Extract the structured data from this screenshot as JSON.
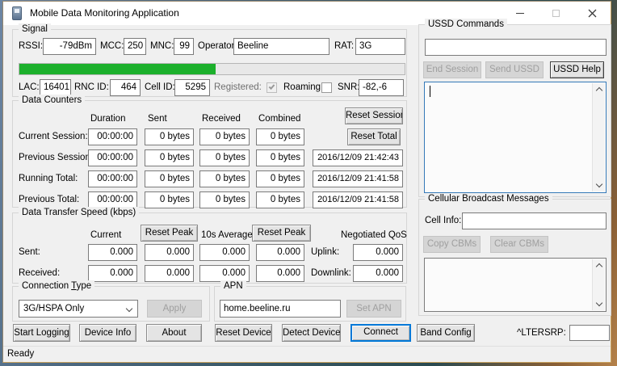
{
  "window": {
    "title": "Mobile Data Monitoring Application"
  },
  "signal": {
    "label": "Signal",
    "rssi_label": "RSSI:",
    "rssi_value": "-79dBm",
    "mcc_label": "MCC:",
    "mcc_value": "250",
    "mnc_label": "MNC:",
    "mnc_value": "99",
    "operator_label": "Operator:",
    "operator_value": "Beeline",
    "rat_label": "RAT:",
    "rat_value": "3G",
    "strength_percent": 51,
    "lac_label": "LAC:",
    "lac_value": "16401",
    "rnc_label": "RNC ID:",
    "rnc_value": "464",
    "cell_label": "Cell ID:",
    "cell_value": "5295",
    "registered_label": "Registered:",
    "registered_checked": true,
    "roaming_label": "Roaming:",
    "roaming_checked": false,
    "snr_label": "SNR:",
    "snr_value": "-82,-6"
  },
  "counters": {
    "label": "Data Counters",
    "col_headers": [
      "Duration",
      "Sent",
      "Received",
      "Combined"
    ],
    "reset_session_label": "Reset Session",
    "reset_total_label": "Reset Total",
    "rows": [
      {
        "label": "Current Session:",
        "duration": "00:00:00",
        "sent": "0 bytes",
        "received": "0 bytes",
        "combined": "0 bytes"
      },
      {
        "label": "Previous Session:",
        "duration": "00:00:00",
        "sent": "0 bytes",
        "received": "0 bytes",
        "combined": "0 bytes",
        "timestamp": "2016/12/09 21:42:43"
      },
      {
        "label": "Running Total:",
        "duration": "00:00:00",
        "sent": "0 bytes",
        "received": "0 bytes",
        "combined": "0 bytes",
        "timestamp": "2016/12/09 21:41:58"
      },
      {
        "label": "Previous Total:",
        "duration": "00:00:00",
        "sent": "0 bytes",
        "received": "0 bytes",
        "combined": "0 bytes",
        "timestamp": "2016/12/09 21:41:58"
      }
    ]
  },
  "speed": {
    "label": "Data Transfer Speed (kbps)",
    "current_header": "Current",
    "reset_peak_label": "Reset Peak",
    "average_header": "10s Average",
    "qos_header": "Negotiated QoS",
    "rows": [
      {
        "label": "Sent:",
        "current": "0.000",
        "current_peak": "0.000",
        "average": "0.000",
        "average_peak": "0.000",
        "qos_label": "Uplink:",
        "qos_value": "0.000"
      },
      {
        "label": "Received:",
        "current": "0.000",
        "current_peak": "0.000",
        "average": "0.000",
        "average_peak": "0.000",
        "qos_label": "Downlink:",
        "qos_value": "0.000"
      }
    ]
  },
  "connection": {
    "label_pre": "Connection ",
    "label_mnemonic": "T",
    "label_post": "ype",
    "selected_option": "3G/HSPA Only",
    "apply_label": "Apply"
  },
  "apn": {
    "label": "APN",
    "value": "home.beeline.ru",
    "set_apn_label": "Set APN"
  },
  "ussd": {
    "label": "USSD Commands",
    "input_value": "",
    "end_session_label": "End Session",
    "send_ussd_label": "Send USSD",
    "help_label": "USSD Help",
    "response_text": ""
  },
  "cbm": {
    "label": "Cellular Broadcast Messages",
    "cell_info_label": "Cell Info:",
    "cell_info_value": "",
    "copy_label": "Copy CBMs",
    "clear_label": "Clear CBMs",
    "messages_text": ""
  },
  "actions": {
    "start_logging": "Start Logging",
    "device_info": "Device Info",
    "about": "About",
    "reset_device": "Reset Device",
    "detect_device": "Detect Device",
    "connect": "Connect",
    "band_config": "Band Config",
    "ltersrp_label": "^LTERSRP:",
    "ltersrp_value": ""
  },
  "statusbar": {
    "text": "Ready"
  },
  "colors": {
    "progress_green": "#1CB02C",
    "default_button_border": "#0078D7",
    "focused_textarea_border": "#3579B8"
  }
}
